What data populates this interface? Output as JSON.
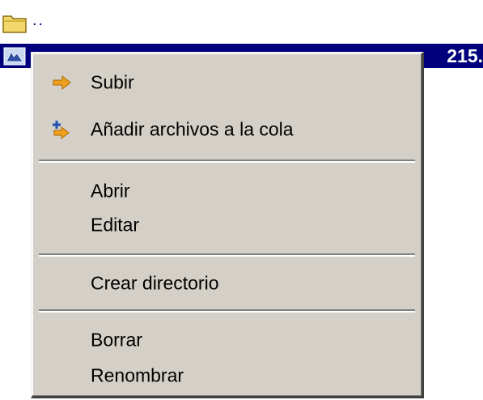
{
  "file_list": {
    "parent_row": {
      "icon": "folder-icon",
      "label": ".."
    },
    "selected_row": {
      "icon": "file-icon",
      "size_text": "215."
    }
  },
  "context_menu": {
    "items": [
      {
        "id": "upload",
        "label": "Subir",
        "icon": "arrow-right-icon"
      },
      {
        "id": "queue",
        "label": "Añadir archivos a la cola",
        "icon": "add-to-queue-icon"
      },
      {
        "id": "open",
        "label": "Abrir"
      },
      {
        "id": "edit",
        "label": "Editar"
      },
      {
        "id": "mkdir",
        "label": "Crear directorio"
      },
      {
        "id": "delete",
        "label": "Borrar"
      },
      {
        "id": "rename",
        "label": "Renombrar"
      }
    ]
  },
  "colors": {
    "selection_background": "#00007d",
    "menu_background": "#d4d0c8",
    "arrow_orange": "#f0a020"
  }
}
